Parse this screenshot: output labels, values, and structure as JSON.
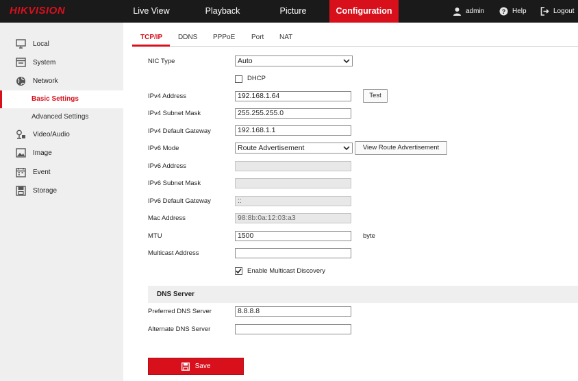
{
  "brand": {
    "logo_text": "HIKVISION",
    "accent_color": "#d7101c"
  },
  "nav": {
    "items": [
      {
        "label": "Live View"
      },
      {
        "label": "Playback"
      },
      {
        "label": "Picture"
      },
      {
        "label": "Configuration",
        "active": true
      }
    ],
    "user": {
      "name": "admin",
      "help": "Help",
      "logout": "Logout"
    }
  },
  "sidebar": {
    "items": [
      {
        "label": "Local",
        "icon": "monitor-icon"
      },
      {
        "label": "System",
        "icon": "system-icon"
      },
      {
        "label": "Network",
        "icon": "globe-icon"
      },
      {
        "label": "Video/Audio",
        "icon": "video-audio-icon"
      },
      {
        "label": "Image",
        "icon": "image-icon"
      },
      {
        "label": "Event",
        "icon": "calendar-icon"
      },
      {
        "label": "Storage",
        "icon": "storage-icon"
      }
    ],
    "network_sub": [
      {
        "label": "Basic Settings",
        "active": true
      },
      {
        "label": "Advanced Settings"
      }
    ]
  },
  "tabs": [
    {
      "label": "TCP/IP",
      "active": true
    },
    {
      "label": "DDNS"
    },
    {
      "label": "PPPoE"
    },
    {
      "label": "Port"
    },
    {
      "label": "NAT"
    }
  ],
  "form": {
    "nic_type": {
      "label": "NIC Type",
      "value": "Auto"
    },
    "dhcp": {
      "label": "DHCP",
      "checked": false
    },
    "ipv4_address": {
      "label": "IPv4 Address",
      "value": "192.168.1.64",
      "button": "Test"
    },
    "ipv4_subnet": {
      "label": "IPv4 Subnet Mask",
      "value": "255.255.255.0"
    },
    "ipv4_gateway": {
      "label": "IPv4 Default Gateway",
      "value": "192.168.1.1"
    },
    "ipv6_mode": {
      "label": "IPv6 Mode",
      "value": "Route Advertisement",
      "button": "View Route Advertisement"
    },
    "ipv6_address": {
      "label": "IPv6 Address",
      "value": ""
    },
    "ipv6_subnet": {
      "label": "IPv6 Subnet Mask",
      "value": ""
    },
    "ipv6_gateway": {
      "label": "IPv6 Default Gateway",
      "value": "::"
    },
    "mac_address": {
      "label": "Mac Address",
      "value": "98:8b:0a:12:03:a3"
    },
    "mtu": {
      "label": "MTU",
      "value": "1500",
      "unit": "byte"
    },
    "multicast_address": {
      "label": "Multicast Address",
      "value": ""
    },
    "multicast_discovery": {
      "label": "Enable Multicast Discovery",
      "checked": true
    }
  },
  "dns": {
    "header": "DNS Server",
    "preferred": {
      "label": "Preferred DNS Server",
      "value": "8.8.8.8"
    },
    "alternate": {
      "label": "Alternate DNS Server",
      "value": ""
    }
  },
  "save_label": "Save"
}
